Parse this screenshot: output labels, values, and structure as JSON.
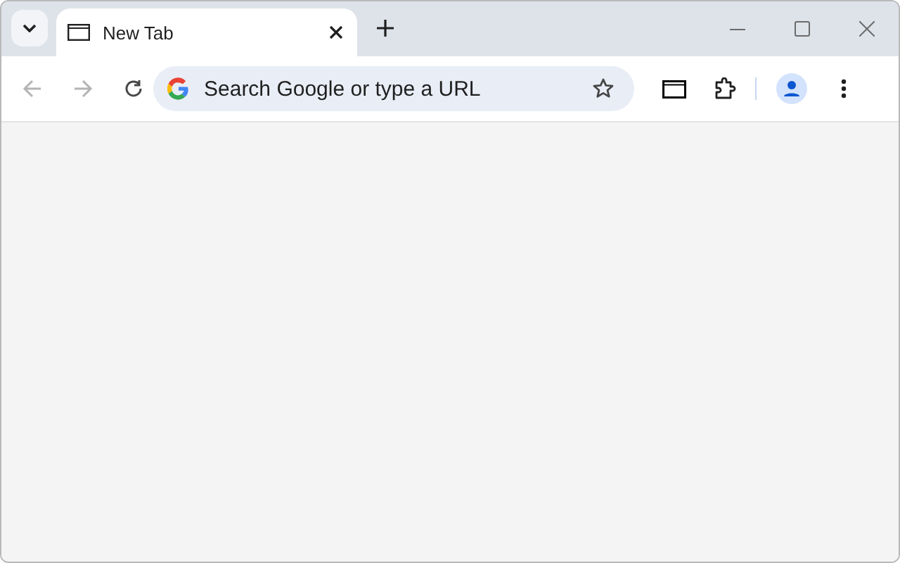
{
  "tabs": [
    {
      "title": "New Tab",
      "selected": true
    }
  ],
  "toolbar": {
    "back_disabled": true,
    "forward_disabled": true
  },
  "omnibox": {
    "placeholder": "Search Google or type a URL",
    "bookmarked": false
  }
}
